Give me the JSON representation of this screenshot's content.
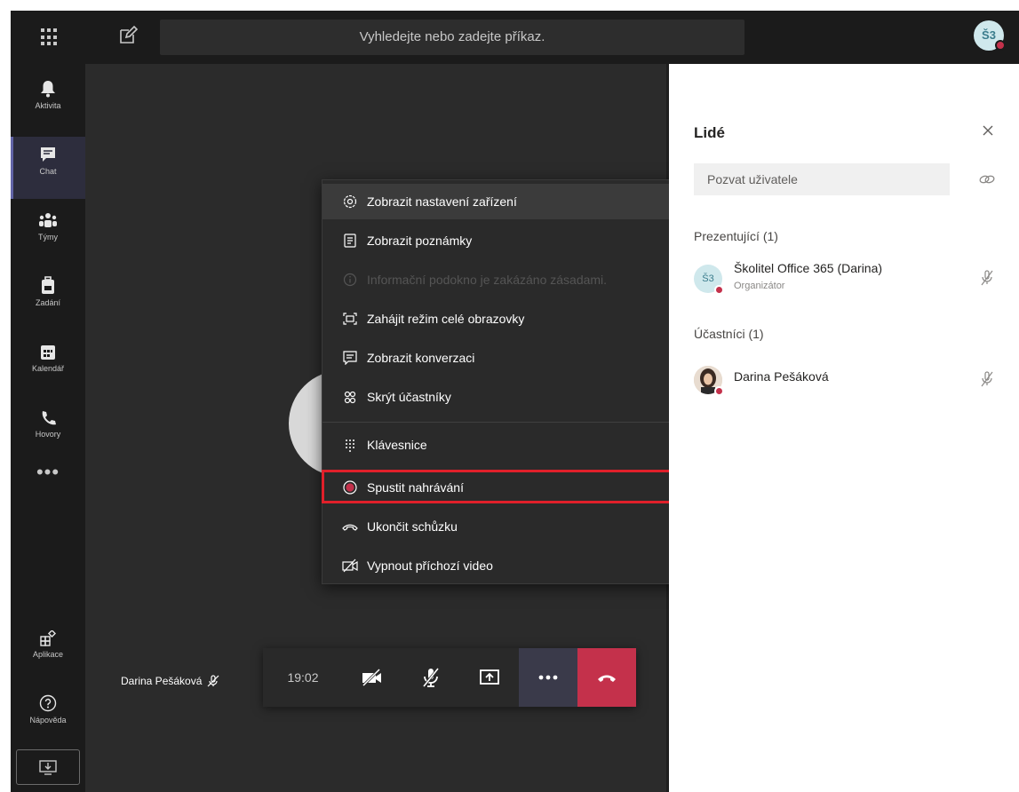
{
  "topbar": {
    "search_placeholder": "Vyhledejte nebo zadejte příkaz.",
    "avatar_initials": "Š3"
  },
  "rail": {
    "items": [
      {
        "label": "Aktivita",
        "icon": "bell-icon"
      },
      {
        "label": "Chat",
        "icon": "chat-icon",
        "active": true
      },
      {
        "label": "Týmy",
        "icon": "teams-icon"
      },
      {
        "label": "Zadání",
        "icon": "assignments-icon"
      },
      {
        "label": "Kalendář",
        "icon": "calendar-icon"
      },
      {
        "label": "Hovory",
        "icon": "phone-icon"
      }
    ],
    "more": "•••",
    "apps_label": "Aplikace",
    "help_label": "Nápověda"
  },
  "stage": {
    "participant_name": "Darina Pešáková"
  },
  "controls": {
    "timer": "19:02"
  },
  "menu": {
    "items": [
      {
        "label": "Zobrazit nastavení zařízení",
        "icon": "settings-icon"
      },
      {
        "label": "Zobrazit poznámky",
        "icon": "notes-icon"
      },
      {
        "label": "Informační podokno je zakázáno zásadami.",
        "icon": "info-icon"
      },
      {
        "label": "Zahájit režim celé obrazovky",
        "icon": "fullscreen-icon"
      },
      {
        "label": "Zobrazit konverzaci",
        "icon": "conversation-icon"
      },
      {
        "label": "Skrýt účastníky",
        "icon": "participants-icon"
      },
      {
        "label": "Klávesnice",
        "icon": "keypad-icon"
      },
      {
        "label": "Spustit nahrávání",
        "icon": "record-icon"
      },
      {
        "label": "Ukončit schůzku",
        "icon": "end-meeting-icon"
      },
      {
        "label": "Vypnout příchozí video",
        "icon": "video-off-icon"
      }
    ]
  },
  "panel": {
    "title": "Lidé",
    "invite_placeholder": "Pozvat uživatele",
    "presenters_heading": "Prezentující (1)",
    "attendees_heading": "Účastníci (1)",
    "presenter": {
      "name": "Školitel Office 365 (Darina)",
      "role": "Organizátor",
      "initials": "Š3"
    },
    "attendee": {
      "name": "Darina Pešáková"
    }
  },
  "colors": {
    "accent": "#6264a7",
    "hangup": "#c4314b",
    "highlight": "#e0202a"
  }
}
